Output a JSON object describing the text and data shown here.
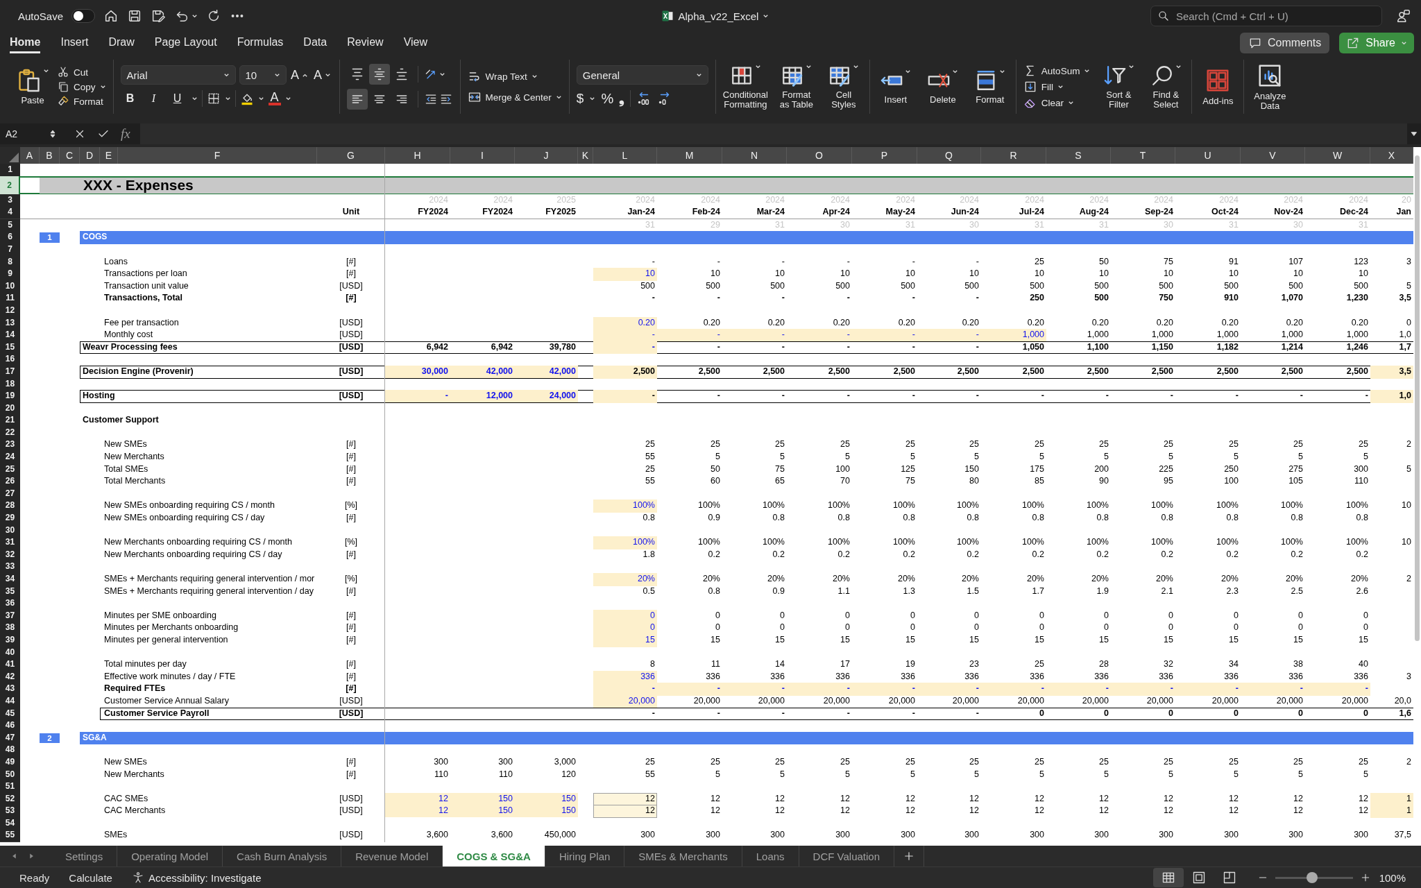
{
  "title_bar": {
    "autosave": {
      "label": "AutoSave",
      "on": false
    },
    "file_name": "Alpha_v22_Excel",
    "search": {
      "placeholder": "Search (Cmd + Ctrl + U)"
    }
  },
  "ribbon_tabs": [
    {
      "label": "Home",
      "selected": true
    },
    {
      "label": "Insert",
      "selected": false
    },
    {
      "label": "Draw",
      "selected": false
    },
    {
      "label": "Page Layout",
      "selected": false
    },
    {
      "label": "Formulas",
      "selected": false
    },
    {
      "label": "Data",
      "selected": false
    },
    {
      "label": "Review",
      "selected": false
    },
    {
      "label": "View",
      "selected": false
    }
  ],
  "actions": {
    "comments": "Comments",
    "share": "Share"
  },
  "ribbon": {
    "paste": "Paste",
    "cut": "Cut",
    "copy": "Copy",
    "format_painter": "Format",
    "font": "Arial",
    "font_size": "10",
    "grow_font": "A",
    "shrink_font": "A",
    "bold": "B",
    "italic": "I",
    "underline": "U",
    "font_color": "A",
    "vertical_align": [
      {
        "kind": "top",
        "selected": false
      },
      {
        "kind": "middle",
        "selected": true
      },
      {
        "kind": "bottom",
        "selected": false
      }
    ],
    "horizontal_align": [
      {
        "kind": "left",
        "selected": true
      },
      {
        "kind": "center",
        "selected": false
      },
      {
        "kind": "right",
        "selected": false
      }
    ],
    "wrap_text": "Wrap Text",
    "merge_center": "Merge & Center",
    "number_format": "General",
    "currency": "$",
    "percent": "%",
    "comma": "❟",
    "style_buttons": [
      {
        "kind": "conditional-formatting",
        "label": "Conditional\nFormatting"
      },
      {
        "kind": "format-table",
        "label": "Format\nas Table"
      },
      {
        "kind": "cell-styles",
        "label": "Cell\nStyles"
      }
    ],
    "cell_buttons": [
      {
        "kind": "insert",
        "label": "Insert"
      },
      {
        "kind": "delete",
        "label": "Delete"
      },
      {
        "kind": "format",
        "label": "Format"
      }
    ],
    "editing": [
      {
        "kind": "autosum",
        "label": "AutoSum"
      },
      {
        "kind": "fill",
        "label": "Fill"
      },
      {
        "kind": "clear",
        "label": "Clear"
      }
    ],
    "editing_buttons": [
      {
        "kind": "sort-filter",
        "label": "Sort &\nFilter"
      },
      {
        "kind": "find-select",
        "label": "Find &\nSelect"
      }
    ],
    "addin_buttons": [
      {
        "kind": "add-ins",
        "label": "Add-ins"
      },
      {
        "kind": "analyze",
        "label": "Analyze\nData"
      }
    ]
  },
  "formula_bar": {
    "name_box": "A2",
    "function_label": "fx"
  },
  "sheet": {
    "columns": [
      "A",
      "B",
      "C",
      "D",
      "E",
      "F",
      "G",
      "H",
      "I",
      "J",
      "K",
      "L",
      "M",
      "N",
      "O",
      "P",
      "Q",
      "R",
      "S",
      "T",
      "U",
      "V",
      "W",
      "X"
    ],
    "rows": [
      {
        "number": "1",
        "kind": "blank",
        "selected": false
      },
      {
        "number": "2",
        "kind": "title",
        "label": "XXX - Expenses",
        "selected": true
      },
      {
        "number": "3",
        "kind": "years",
        "annual": [
          "2024",
          "2024",
          "2025"
        ],
        "months": [
          "2024",
          "2024",
          "2024",
          "2024",
          "2024",
          "2024",
          "2024",
          "2024",
          "2024",
          "2024",
          "2024",
          "2024"
        ],
        "next": "20",
        "selected": false
      },
      {
        "number": "4",
        "kind": "headers",
        "unit": "Unit",
        "annual": [
          "FY2024",
          "FY2024",
          "FY2025"
        ],
        "months": [
          "Jan-24",
          "Feb-24",
          "Mar-24",
          "Apr-24",
          "May-24",
          "Jun-24",
          "Jul-24",
          "Aug-24",
          "Sep-24",
          "Oct-24",
          "Nov-24",
          "Dec-24"
        ],
        "next": "Jan",
        "selected": false
      },
      {
        "number": "5",
        "kind": "days",
        "months": [
          "31",
          "29",
          "31",
          "30",
          "31",
          "30",
          "31",
          "31",
          "30",
          "31",
          "30",
          "31"
        ],
        "selected": false
      },
      {
        "number": "6",
        "kind": "section",
        "index": "1",
        "label": "COGS",
        "selected": false
      },
      {
        "number": "7",
        "kind": "blank",
        "selected": false
      },
      {
        "number": "8",
        "kind": "line",
        "label": "Loans",
        "unit": "[#]",
        "months": [
          "-",
          "-",
          "-",
          "-",
          "-",
          "-",
          "25",
          "50",
          "75",
          "91",
          "107",
          "123"
        ],
        "next": "3",
        "selected": false
      },
      {
        "number": "9",
        "kind": "line",
        "label": "Transactions per loan",
        "unit": "[#]",
        "months": [
          {
            "text": "10",
            "kind": "input"
          },
          "10",
          "10",
          "10",
          "10",
          "10",
          "10",
          "10",
          "10",
          "10",
          "10",
          "10"
        ],
        "selected": false
      },
      {
        "number": "10",
        "kind": "line",
        "label": "Transaction unit value",
        "unit": "[USD]",
        "months": [
          "500",
          "500",
          "500",
          "500",
          "500",
          "500",
          "500",
          "500",
          "500",
          "500",
          "500",
          "500"
        ],
        "next": "5",
        "selected": false
      },
      {
        "number": "11",
        "kind": "line-bold",
        "label": "Transactions, Total",
        "unit": "[#]",
        "months": [
          "-",
          "-",
          "-",
          "-",
          "-",
          "-",
          "250",
          "500",
          "750",
          "910",
          "1,070",
          "1,230"
        ],
        "next": "3,5",
        "selected": false
      },
      {
        "number": "12",
        "kind": "blank",
        "selected": false
      },
      {
        "number": "13",
        "kind": "line",
        "label": "Fee per transaction",
        "unit": "[USD]",
        "months": [
          {
            "text": "0.20",
            "kind": "input"
          },
          "0.20",
          "0.20",
          "0.20",
          "0.20",
          "0.20",
          "0.20",
          "0.20",
          "0.20",
          "0.20",
          "0.20",
          "0.20"
        ],
        "next": "0",
        "selected": false
      },
      {
        "number": "14",
        "kind": "line",
        "label": "Monthly cost",
        "unit": "[USD]",
        "months": [
          {
            "text": "-",
            "kind": "input"
          },
          {
            "text": "-",
            "kind": "input"
          },
          {
            "text": "-",
            "kind": "input"
          },
          {
            "text": "-",
            "kind": "input"
          },
          {
            "text": "-",
            "kind": "input"
          },
          {
            "text": "-",
            "kind": "input"
          },
          {
            "text": "1,000",
            "kind": "input"
          },
          "1,000",
          "1,000",
          "1,000",
          "1,000",
          "1,000"
        ],
        "next": "1,0",
        "selected": false
      },
      {
        "number": "15",
        "kind": "total",
        "label": "Weavr Processing fees",
        "unit": "[USD]",
        "annual": [
          "6,942",
          "6,942",
          "39,780"
        ],
        "months": [
          {
            "text": "-",
            "kind": "input"
          },
          "-",
          "-",
          "-",
          "-",
          "-",
          "1,050",
          "1,100",
          "1,150",
          "1,182",
          "1,214",
          "1,246"
        ],
        "next": "1,7",
        "selected": false
      },
      {
        "number": "16",
        "kind": "blank",
        "selected": false
      },
      {
        "number": "17",
        "kind": "total",
        "label": "Decision Engine (Provenir)",
        "unit": "[USD]",
        "annual": [
          {
            "text": "30,000",
            "kind": "input"
          },
          {
            "text": "42,000",
            "kind": "input"
          },
          {
            "text": "42,000",
            "kind": "input"
          }
        ],
        "months": [
          {
            "text": "2,500",
            "kind": "shade"
          },
          "2,500",
          "2,500",
          "2,500",
          "2,500",
          "2,500",
          "2,500",
          "2,500",
          "2,500",
          "2,500",
          "2,500",
          "2,500"
        ],
        "next": {
          "text": "3,5",
          "kind": "shade"
        },
        "selected": false
      },
      {
        "number": "18",
        "kind": "blank",
        "selected": false
      },
      {
        "number": "19",
        "kind": "total",
        "label": "Hosting",
        "unit": "[USD]",
        "annual": [
          {
            "text": "-",
            "kind": "input"
          },
          {
            "text": "12,000",
            "kind": "input"
          },
          {
            "text": "24,000",
            "kind": "input"
          }
        ],
        "months": [
          {
            "text": "-",
            "kind": "shade"
          },
          "-",
          "-",
          "-",
          "-",
          "-",
          "-",
          "-",
          "-",
          "-",
          "-",
          "-"
        ],
        "next": {
          "text": "1,0",
          "kind": "shade"
        },
        "selected": false
      },
      {
        "number": "20",
        "kind": "blank",
        "selected": false
      },
      {
        "number": "21",
        "kind": "group",
        "label": "Customer Support",
        "selected": false
      },
      {
        "number": "22",
        "kind": "blank",
        "selected": false
      },
      {
        "number": "23",
        "kind": "line",
        "label": "New SMEs",
        "unit": "[#]",
        "months": [
          "25",
          "25",
          "25",
          "25",
          "25",
          "25",
          "25",
          "25",
          "25",
          "25",
          "25",
          "25"
        ],
        "next": "2",
        "selected": false
      },
      {
        "number": "24",
        "kind": "line",
        "label": "New Merchants",
        "unit": "[#]",
        "months": [
          "55",
          "5",
          "5",
          "5",
          "5",
          "5",
          "5",
          "5",
          "5",
          "5",
          "5",
          "5"
        ],
        "selected": false
      },
      {
        "number": "25",
        "kind": "line",
        "label": "Total SMEs",
        "unit": "[#]",
        "months": [
          "25",
          "50",
          "75",
          "100",
          "125",
          "150",
          "175",
          "200",
          "225",
          "250",
          "275",
          "300"
        ],
        "next": "5",
        "selected": false
      },
      {
        "number": "26",
        "kind": "line",
        "label": "Total Merchants",
        "unit": "[#]",
        "months": [
          "55",
          "60",
          "65",
          "70",
          "75",
          "80",
          "85",
          "90",
          "95",
          "100",
          "105",
          "110"
        ],
        "selected": false
      },
      {
        "number": "27",
        "kind": "blank",
        "selected": false
      },
      {
        "number": "28",
        "kind": "line",
        "label": "New SMEs onboarding requiring CS / month",
        "unit": "[%]",
        "months": [
          {
            "text": "100%",
            "kind": "input"
          },
          "100%",
          "100%",
          "100%",
          "100%",
          "100%",
          "100%",
          "100%",
          "100%",
          "100%",
          "100%",
          "100%"
        ],
        "next": "10",
        "selected": false
      },
      {
        "number": "29",
        "kind": "line",
        "label": "New SMEs onboarding requiring CS / day",
        "unit": "[#]",
        "months": [
          "0.8",
          "0.9",
          "0.8",
          "0.8",
          "0.8",
          "0.8",
          "0.8",
          "0.8",
          "0.8",
          "0.8",
          "0.8",
          "0.8"
        ],
        "selected": false
      },
      {
        "number": "30",
        "kind": "blank",
        "selected": false
      },
      {
        "number": "31",
        "kind": "line",
        "label": "New Merchants onboarding requiring CS / month",
        "unit": "[%]",
        "months": [
          {
            "text": "100%",
            "kind": "input"
          },
          "100%",
          "100%",
          "100%",
          "100%",
          "100%",
          "100%",
          "100%",
          "100%",
          "100%",
          "100%",
          "100%"
        ],
        "next": "10",
        "selected": false
      },
      {
        "number": "32",
        "kind": "line",
        "label": "New Merchants onboarding requiring CS / day",
        "unit": "[#]",
        "months": [
          "1.8",
          "0.2",
          "0.2",
          "0.2",
          "0.2",
          "0.2",
          "0.2",
          "0.2",
          "0.2",
          "0.2",
          "0.2",
          "0.2"
        ],
        "selected": false
      },
      {
        "number": "33",
        "kind": "blank",
        "selected": false
      },
      {
        "number": "34",
        "kind": "line",
        "label": "SMEs + Merchants requiring general intervention / mor",
        "unit": "[%]",
        "months": [
          {
            "text": "20%",
            "kind": "input"
          },
          "20%",
          "20%",
          "20%",
          "20%",
          "20%",
          "20%",
          "20%",
          "20%",
          "20%",
          "20%",
          "20%"
        ],
        "next": "2",
        "selected": false
      },
      {
        "number": "35",
        "kind": "line",
        "label": "SMEs + Merchants requiring general intervention / day",
        "unit": "[#]",
        "months": [
          "0.5",
          "0.8",
          "0.9",
          "1.1",
          "1.3",
          "1.5",
          "1.7",
          "1.9",
          "2.1",
          "2.3",
          "2.5",
          "2.6"
        ],
        "selected": false
      },
      {
        "number": "36",
        "kind": "blank",
        "selected": false
      },
      {
        "number": "37",
        "kind": "line",
        "label": "Minutes per SME onboarding",
        "unit": "[#]",
        "months": [
          {
            "text": "0",
            "kind": "input"
          },
          "0",
          "0",
          "0",
          "0",
          "0",
          "0",
          "0",
          "0",
          "0",
          "0",
          "0"
        ],
        "selected": false
      },
      {
        "number": "38",
        "kind": "line",
        "label": "Minutes per Merchants onboarding",
        "unit": "[#]",
        "months": [
          {
            "text": "0",
            "kind": "input"
          },
          "0",
          "0",
          "0",
          "0",
          "0",
          "0",
          "0",
          "0",
          "0",
          "0",
          "0"
        ],
        "selected": false
      },
      {
        "number": "39",
        "kind": "line",
        "label": "Minutes per general intervention",
        "unit": "[#]",
        "months": [
          {
            "text": "15",
            "kind": "input"
          },
          "15",
          "15",
          "15",
          "15",
          "15",
          "15",
          "15",
          "15",
          "15",
          "15",
          "15"
        ],
        "selected": false
      },
      {
        "number": "40",
        "kind": "blank",
        "selected": false
      },
      {
        "number": "41",
        "kind": "line",
        "label": "Total minutes per day",
        "unit": "[#]",
        "months": [
          "8",
          "11",
          "14",
          "17",
          "19",
          "23",
          "25",
          "28",
          "32",
          "34",
          "38",
          "40"
        ],
        "selected": false
      },
      {
        "number": "42",
        "kind": "line",
        "label": "Effective work minutes / day / FTE",
        "unit": "[#]",
        "months": [
          {
            "text": "336",
            "kind": "input"
          },
          "336",
          "336",
          "336",
          "336",
          "336",
          "336",
          "336",
          "336",
          "336",
          "336",
          "336"
        ],
        "next": "3",
        "selected": false
      },
      {
        "number": "43",
        "kind": "line-bold",
        "label": "Required FTEs",
        "unit": "[#]",
        "months": [
          {
            "text": "-",
            "kind": "input"
          },
          {
            "text": "-",
            "kind": "input"
          },
          {
            "text": "-",
            "kind": "input"
          },
          {
            "text": "-",
            "kind": "input"
          },
          {
            "text": "-",
            "kind": "input"
          },
          {
            "text": "-",
            "kind": "input"
          },
          {
            "text": "-",
            "kind": "input"
          },
          {
            "text": "-",
            "kind": "input"
          },
          {
            "text": "-",
            "kind": "input"
          },
          {
            "text": "-",
            "kind": "input"
          },
          {
            "text": "-",
            "kind": "input"
          },
          {
            "text": "-",
            "kind": "input"
          }
        ],
        "selected": false
      },
      {
        "number": "44",
        "kind": "line",
        "label": "Customer Service Annual Salary",
        "unit": "[USD]",
        "months": [
          {
            "text": "20,000",
            "kind": "input"
          },
          "20,000",
          "20,000",
          "20,000",
          "20,000",
          "20,000",
          "20,000",
          "20,000",
          "20,000",
          "20,000",
          "20,000",
          "20,000"
        ],
        "next": "20,0",
        "selected": false
      },
      {
        "number": "45",
        "kind": "subtotal",
        "label": "Customer Service Payroll",
        "unit": "[USD]",
        "months": [
          "-",
          "-",
          "-",
          "-",
          "-",
          "-",
          "0",
          "0",
          "0",
          "0",
          "0",
          "0"
        ],
        "next": "1,6",
        "selected": false
      },
      {
        "number": "46",
        "kind": "blank",
        "selected": false
      },
      {
        "number": "47",
        "kind": "section",
        "index": "2",
        "label": "SG&A",
        "selected": false
      },
      {
        "number": "48",
        "kind": "blank",
        "selected": false
      },
      {
        "number": "49",
        "kind": "line",
        "label": "New SMEs",
        "unit": "[#]",
        "annual": [
          "300",
          "300",
          "3,000"
        ],
        "months": [
          "25",
          "25",
          "25",
          "25",
          "25",
          "25",
          "25",
          "25",
          "25",
          "25",
          "25",
          "25"
        ],
        "next": "2",
        "selected": false
      },
      {
        "number": "50",
        "kind": "line",
        "label": "New Merchants",
        "unit": "[#]",
        "annual": [
          "110",
          "110",
          "120"
        ],
        "months": [
          "55",
          "5",
          "5",
          "5",
          "5",
          "5",
          "5",
          "5",
          "5",
          "5",
          "5",
          "5"
        ],
        "selected": false
      },
      {
        "number": "51",
        "kind": "blank",
        "selected": false
      },
      {
        "number": "52",
        "kind": "line",
        "label": "CAC SMEs",
        "unit": "[USD]",
        "annual": [
          {
            "text": "12",
            "kind": "input"
          },
          {
            "text": "150",
            "kind": "input"
          },
          {
            "text": "150",
            "kind": "input"
          }
        ],
        "months": [
          {
            "text": "12",
            "kind": "outlined"
          },
          "12",
          "12",
          "12",
          "12",
          "12",
          "12",
          "12",
          "12",
          "12",
          "12",
          "12"
        ],
        "next": {
          "text": "1",
          "kind": "shade"
        },
        "selected": false
      },
      {
        "number": "53",
        "kind": "line",
        "label": "CAC Merchants",
        "unit": "[USD]",
        "annual": [
          {
            "text": "12",
            "kind": "input"
          },
          {
            "text": "150",
            "kind": "input"
          },
          {
            "text": "150",
            "kind": "input"
          }
        ],
        "months": [
          {
            "text": "12",
            "kind": "outlined"
          },
          "12",
          "12",
          "12",
          "12",
          "12",
          "12",
          "12",
          "12",
          "12",
          "12",
          "12"
        ],
        "next": {
          "text": "1",
          "kind": "shade"
        },
        "selected": false
      },
      {
        "number": "54",
        "kind": "blank",
        "selected": false
      },
      {
        "number": "55",
        "kind": "line",
        "label": "SMEs",
        "unit": "[USD]",
        "annual": [
          "3,600",
          "3,600",
          "450,000"
        ],
        "months": [
          "300",
          "300",
          "300",
          "300",
          "300",
          "300",
          "300",
          "300",
          "300",
          "300",
          "300",
          "300"
        ],
        "next": "37,5",
        "selected": false
      }
    ]
  },
  "sheet_tabs": [
    {
      "label": "Settings",
      "selected": false
    },
    {
      "label": "Operating Model",
      "selected": false
    },
    {
      "label": "Cash Burn Analysis",
      "selected": false
    },
    {
      "label": "Revenue Model",
      "selected": false
    },
    {
      "label": "COGS & SG&A",
      "selected": true
    },
    {
      "label": "Hiring Plan",
      "selected": false
    },
    {
      "label": "SMEs & Merchants",
      "selected": false
    },
    {
      "label": "Loans",
      "selected": false
    },
    {
      "label": "DCF Valuation",
      "selected": false
    }
  ],
  "status_bar": {
    "ready": "Ready",
    "calculate": "Calculate",
    "accessibility": "Accessibility: Investigate",
    "view_modes": [
      {
        "kind": "normal",
        "selected": true
      },
      {
        "kind": "page-layout",
        "selected": false
      },
      {
        "kind": "page-break",
        "selected": false
      }
    ],
    "zoom": {
      "level": 0.48,
      "reading": "100%"
    }
  }
}
